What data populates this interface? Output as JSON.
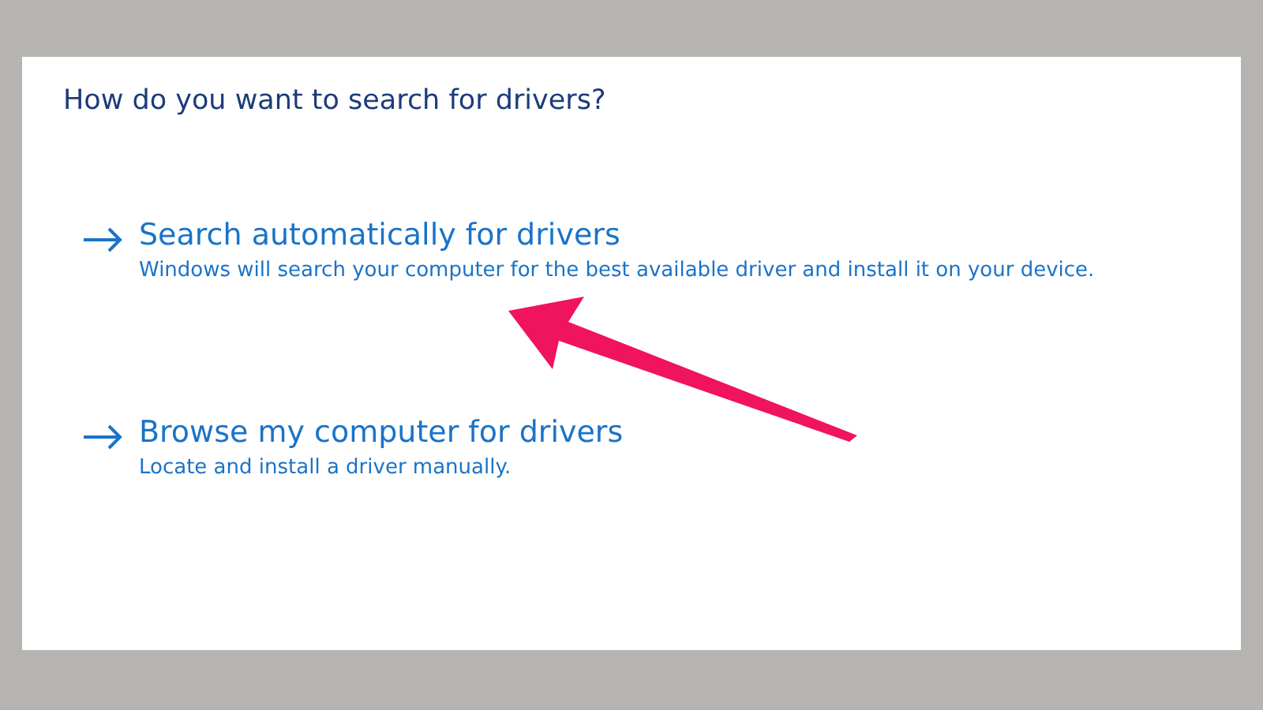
{
  "heading": "How do you want to search for drivers?",
  "options": [
    {
      "title": "Search automatically for drivers",
      "description": "Windows will search your computer for the best available driver and install it on your device."
    },
    {
      "title": "Browse my computer for drivers",
      "description": "Locate and install a driver manually."
    }
  ]
}
